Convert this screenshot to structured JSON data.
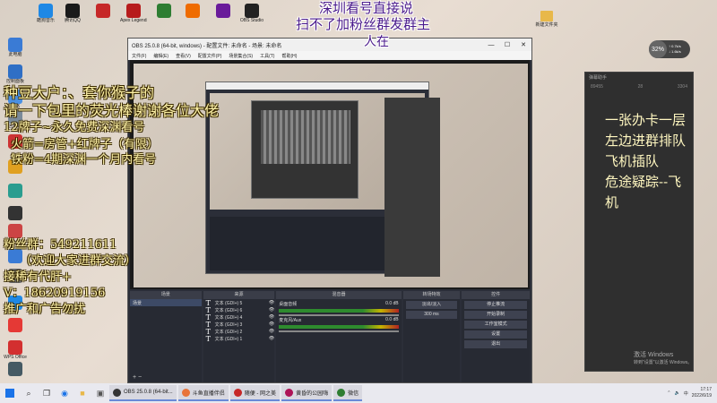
{
  "desktop": {
    "icons_col1": [
      {
        "label": "此电脑",
        "color": "#3a7bd5"
      },
      {
        "label": "控制面板",
        "color": "#2f6fc5"
      },
      {
        "label": "网络",
        "color": "#4a90e2"
      },
      {
        "label": "回收站",
        "color": "#7a8a99"
      },
      {
        "label": "",
        "color": "#cc3333"
      },
      {
        "label": "",
        "color": "#e0a020"
      },
      {
        "label": "",
        "color": "#2a9d8f"
      },
      {
        "label": "",
        "color": "#333333"
      },
      {
        "label": "",
        "color": "#cc4444"
      },
      {
        "label": "",
        "color": "#3a7bd5"
      },
      {
        "label": "",
        "color": "#666666"
      },
      {
        "label": "",
        "color": "#1e88e5"
      },
      {
        "label": "",
        "color": "#e53935"
      },
      {
        "label": "WPS Office",
        "color": "#d32f2f"
      },
      {
        "label": "",
        "color": "#455a64"
      }
    ],
    "icons_top_row": [
      {
        "label": "酷狗音乐",
        "color": "#1e88e5"
      },
      {
        "label": "腾讯QQ",
        "color": "#1a1a1a"
      },
      {
        "label": "",
        "color": "#c62828"
      },
      {
        "label": "Apex Legends",
        "color": "#b71c1c"
      },
      {
        "label": "",
        "color": "#2e7d32"
      },
      {
        "label": "",
        "color": "#ef6c00"
      },
      {
        "label": "",
        "color": "#6a1b9a"
      },
      {
        "label": "OBS Studio",
        "color": "#222222"
      }
    ],
    "folder_label": "新建文件夹"
  },
  "overlays": {
    "top_line1": "深圳看号直接说",
    "top_line2": "扫不了加粉丝群发群主",
    "top_line3": "人在",
    "left_line1": "种豆大户：、套你猴子的",
    "left_line2": "请一下包里的荧光棒谢谢各位大佬",
    "left_line3": "12牌子~永久免费深渊看号",
    "left_line4": "火箭=房管+红牌子（有限）",
    "left_line5": "铁粉=4期深渊一个月内看号",
    "left_line6": "粉丝群：549211611",
    "left_line7": "（欢迎大家进群交流）",
    "left_line8": "接稀有代肝+",
    "left_line9": "V：18620919156",
    "left_line10": "推广和广告勿扰"
  },
  "obs": {
    "title": "OBS 25.0.8 (64-bit, windows) - 配置文件: 未命名 - 场景: 未命名",
    "menu": [
      "文件(F)",
      "编辑(E)",
      "查看(V)",
      "配置文件(P)",
      "场景集合(S)",
      "工具(T)",
      "帮助(H)"
    ],
    "docks": {
      "scenes_title": "场景",
      "sources_title": "来源",
      "mixer_title": "混音器",
      "transitions_title": "转场特效",
      "controls_title": "控件"
    },
    "scene_name": "场景",
    "sources": [
      "文本 (GDI+) 5",
      "文本 (GDI+) 6",
      "文本 (GDI+) 4",
      "文本 (GDI+) 3",
      "文本 (GDI+) 2",
      "文本 (GDI+) 1"
    ],
    "mixer": [
      {
        "name": "桌面音频",
        "level": "0.0 dB"
      },
      {
        "name": "麦克风/Aux",
        "level": "0.0 dB"
      }
    ],
    "transition": "淡出/淡入",
    "transition_duration": "300 ms",
    "controls": [
      "停止推流",
      "开始录制",
      "工作室模式",
      "设置",
      "退出"
    ]
  },
  "right_panel": {
    "header": "弹幕助手",
    "stats": [
      "89455",
      "28",
      "3304"
    ],
    "msg1": "一张办卡一层",
    "msg2": "左边进群排队",
    "msg3": "飞机插队",
    "msg4": "危途疑踪--飞机",
    "activate": "激活 Windows",
    "activate_sub": "转到\"设置\"以激活 Windows。"
  },
  "net": {
    "percent": "32%",
    "up": "↑ 0.7k/s",
    "down": "↓ 1.6k/s"
  },
  "taskbar": {
    "apps": [
      {
        "label": "OBS 25.0.8 (64-bit...",
        "color": "#333333"
      },
      {
        "label": "斗鱼直播伴侣",
        "color": "#e8743a"
      },
      {
        "label": "随便 - 网之美",
        "color": "#c62828"
      },
      {
        "label": "黄昏的公园嗨",
        "color": "#ad1457"
      },
      {
        "label": "微信",
        "color": "#2e7d32"
      }
    ],
    "time": "17:17",
    "date": "2022/6/19",
    "lang": "中"
  }
}
